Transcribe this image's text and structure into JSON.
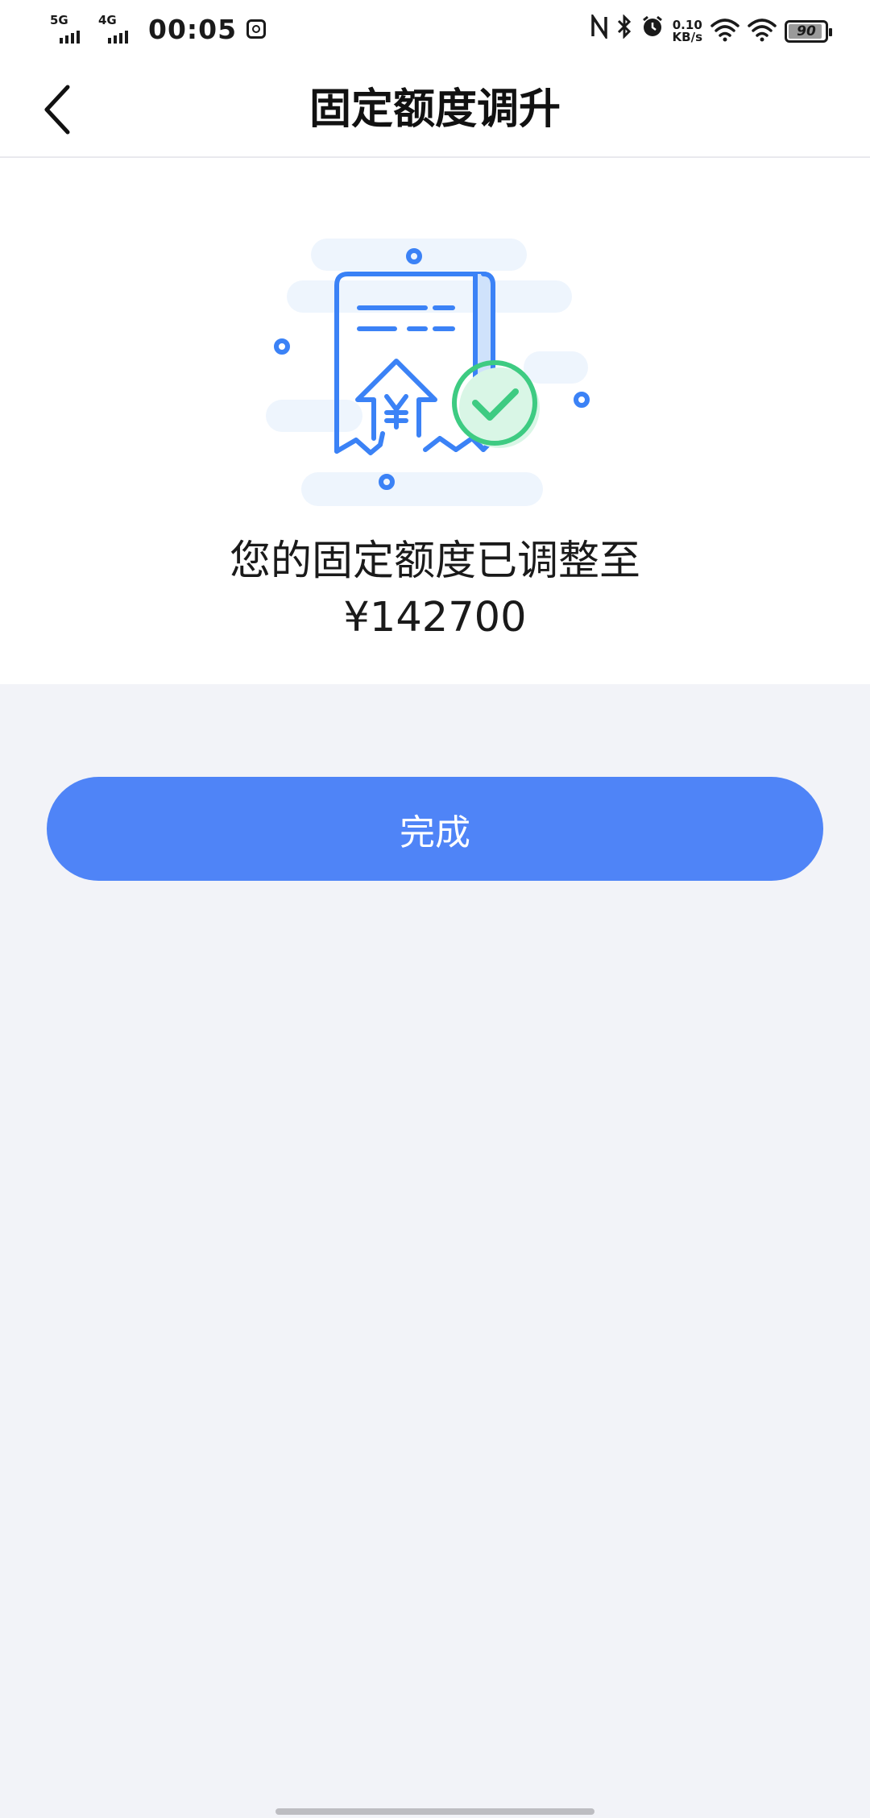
{
  "status_bar": {
    "sim1_label": "5G",
    "sim2_label": "4G",
    "time": "00:05",
    "net_speed_value": "0.10",
    "net_speed_unit": "KB/s",
    "battery_level": "90",
    "icons": [
      "signal-5g-icon",
      "signal-4g-icon",
      "app-notification-icon",
      "nfc-icon",
      "bluetooth-icon",
      "alarm-icon",
      "wifi-icon",
      "wifi-icon",
      "battery-icon"
    ]
  },
  "header": {
    "title": "固定额度调升",
    "back_icon": "chevron-left-icon"
  },
  "result": {
    "illustration_icon": "receipt-check-illustration",
    "message": "您的固定额度已调整至",
    "amount": "¥142700"
  },
  "actions": {
    "done_label": "完成"
  },
  "colors": {
    "accent": "#4f84f7",
    "illustration_blue": "#3b82f6",
    "success_green": "#3ecb82",
    "page_background": "#f2f3f8"
  }
}
